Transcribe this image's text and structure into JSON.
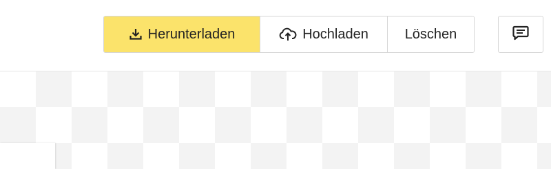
{
  "toolbar": {
    "download_label": "Herunterladen",
    "upload_label": "Hochladen",
    "delete_label": "Löschen"
  },
  "icons": {
    "download": "download-icon",
    "upload": "cloud-upload-icon",
    "comment": "comment-icon"
  },
  "colors": {
    "primary": "#fbe36b"
  }
}
